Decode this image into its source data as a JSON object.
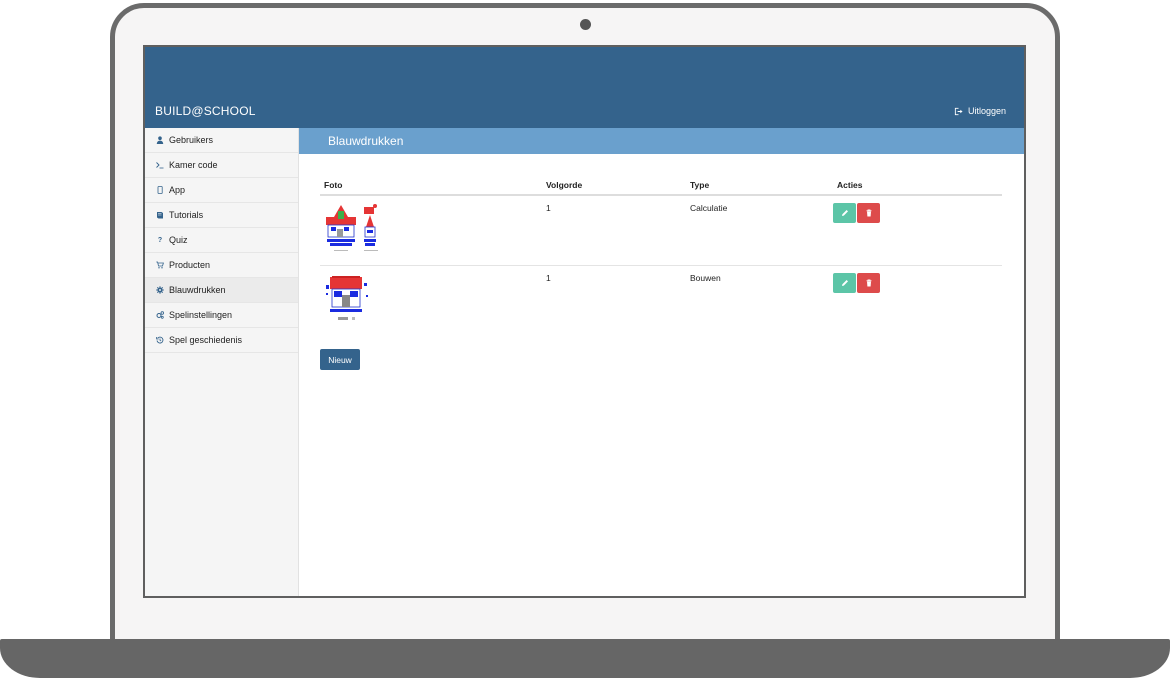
{
  "header": {
    "brand": "BUILD@SCHOOL",
    "logout_label": "Uitloggen"
  },
  "sidebar": {
    "items": [
      {
        "label": "Gebruikers",
        "icon": "user-icon"
      },
      {
        "label": "Kamer code",
        "icon": "terminal-icon"
      },
      {
        "label": "App",
        "icon": "mobile-icon"
      },
      {
        "label": "Tutorials",
        "icon": "book-icon"
      },
      {
        "label": "Quiz",
        "icon": "question-icon"
      },
      {
        "label": "Producten",
        "icon": "cart-icon"
      },
      {
        "label": "Blauwdrukken",
        "icon": "gear-icon"
      },
      {
        "label": "Spelinstellingen",
        "icon": "gears-icon"
      },
      {
        "label": "Spel geschiedenis",
        "icon": "history-icon"
      }
    ],
    "active_index": 6
  },
  "main": {
    "section_title": "Blauwdrukken",
    "table": {
      "headers": [
        "Foto",
        "Volgorde",
        "Type",
        "Acties"
      ],
      "rows": [
        {
          "volgorde": "1",
          "type": "Calculatie"
        },
        {
          "volgorde": "1",
          "type": "Bouwen"
        }
      ]
    },
    "new_button": "Nieuw"
  },
  "colors": {
    "primary": "#34638c",
    "section_bar": "#6aa0cd",
    "edit": "#5cc5a7",
    "delete": "#dd4b4b"
  }
}
